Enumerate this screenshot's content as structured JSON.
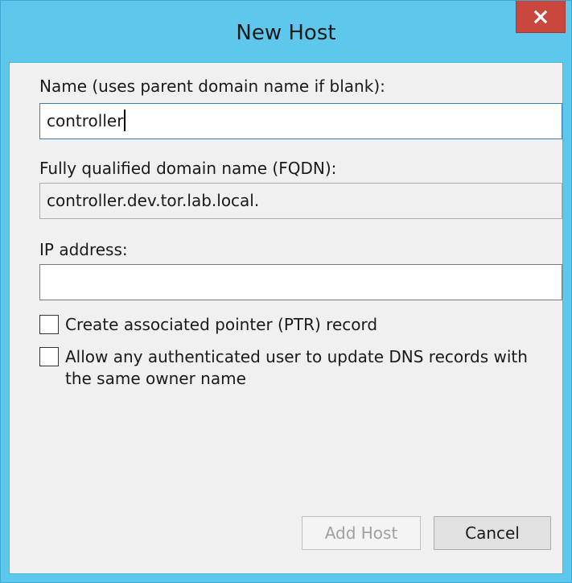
{
  "window": {
    "title": "New Host",
    "close_glyph": "x"
  },
  "form": {
    "name_label": "Name (uses parent domain name if blank):",
    "name_value": "controller",
    "fqdn_label": "Fully qualified domain name (FQDN):",
    "fqdn_value": "controller.dev.tor.lab.local.",
    "ip_label": "IP address:",
    "ip_value": "",
    "ptr_checkbox_label": "Create associated pointer (PTR) record",
    "ptr_checked": false,
    "allow_update_label": "Allow any authenticated user to update DNS records with the same owner name",
    "allow_update_checked": false
  },
  "buttons": {
    "add_host": "Add Host",
    "add_host_enabled": false,
    "cancel": "Cancel"
  },
  "colors": {
    "title_bar": "#5ec8ec",
    "close_button": "#c9473d",
    "dialog_background": "#f0f0f0"
  }
}
